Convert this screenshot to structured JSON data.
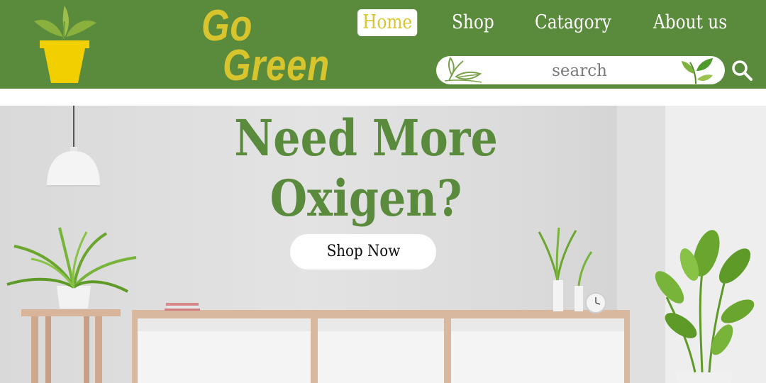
{
  "brand": {
    "line1": "Go",
    "line2": "Green"
  },
  "nav": {
    "home": "Home",
    "shop": "Shop",
    "category": "Catagory",
    "about": "About us"
  },
  "search": {
    "placeholder": "search"
  },
  "hero": {
    "headline_1": "Need More",
    "headline_2": "Oxigen?",
    "cta": "Shop Now"
  },
  "colors": {
    "header_bg": "#5a8a3c",
    "accent_yellow": "#d8c52e",
    "headline_green": "#5a8a3c"
  },
  "icons": {
    "logo": "plant-pot-icon",
    "search": "search-icon",
    "leaf_left": "sprout-outline-icon",
    "leaf_right": "green-leaves-icon"
  }
}
